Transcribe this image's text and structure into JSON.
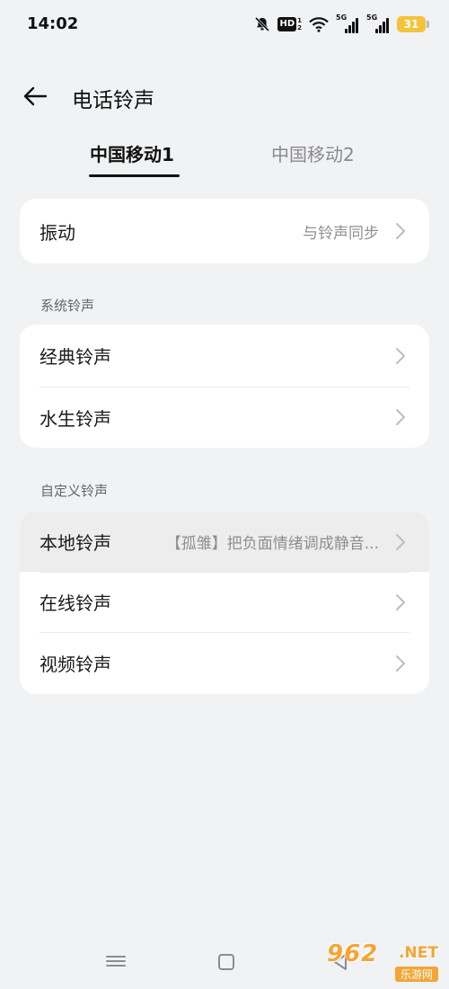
{
  "status_bar": {
    "time": "14:02",
    "icons": [
      "bell-off-icon",
      "hd-icon",
      "wifi-icon",
      "signal-icon",
      "signal-icon",
      "battery-icon"
    ],
    "hd_label": "HD",
    "hd_sub": "1\n2",
    "sim1_tag": "5G",
    "sim2_tag": "5G",
    "battery": "31",
    "battery_color": "#f3c33a"
  },
  "header": {
    "title": "电话铃声"
  },
  "tabs": [
    {
      "label": "中国移动1",
      "active": true
    },
    {
      "label": "中国移动2",
      "active": false
    }
  ],
  "vibration": {
    "label": "振动",
    "value": "与铃声同步"
  },
  "system_section": {
    "title": "系统铃声",
    "items": [
      {
        "label": "经典铃声"
      },
      {
        "label": "水生铃声"
      }
    ]
  },
  "custom_section": {
    "title": "自定义铃声",
    "items": [
      {
        "label": "本地铃声",
        "value": "【孤雏】把负面情绪调成静音..."
      },
      {
        "label": "在线铃声"
      },
      {
        "label": "视频铃声"
      }
    ]
  },
  "watermark": {
    "main": "962",
    "net": ".NET",
    "sub": "乐游网"
  }
}
